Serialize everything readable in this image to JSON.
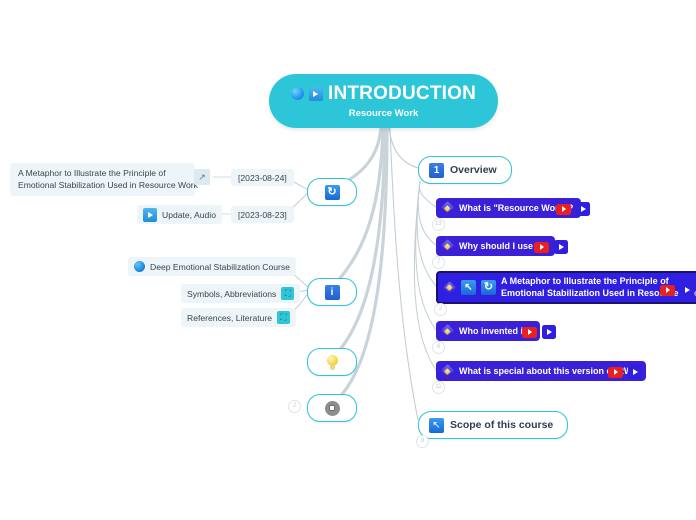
{
  "root": {
    "title": "INTRODUCTION",
    "subtitle": "Resource Work",
    "icons": [
      "sphere-icon",
      "play-icon"
    ]
  },
  "right_branches": [
    {
      "label": "Overview",
      "icon": "number-one-icon",
      "icon_text": "1",
      "type": "outline"
    },
    {
      "label": "Scope of this course",
      "icon": "arrow-expand-icon",
      "icon_text": "↖",
      "type": "outline"
    }
  ],
  "topics": [
    {
      "label": "What is \"Resource Work\"?",
      "icons": [
        "gem-icon"
      ],
      "badges": [
        "youtube-badge",
        "play-badge"
      ],
      "count": "13"
    },
    {
      "label": "Why should I use it?",
      "icons": [
        "gem-icon"
      ],
      "badges": [
        "youtube-badge",
        "play-badge"
      ],
      "count": "7"
    },
    {
      "label_line1": "A Metaphor to Illustrate the Principle of",
      "label_line2": "Emotional Stabilization Used in Resource Work",
      "icons": [
        "gem-icon",
        "arrow-expand-icon",
        "sync-icon"
      ],
      "badges": [
        "youtube-badge",
        "play-badge"
      ],
      "count": "2",
      "selected": true
    },
    {
      "label": "Who invented it?",
      "icons": [
        "gem-icon"
      ],
      "badges": [
        "youtube-badge",
        "play-badge"
      ],
      "count": "6"
    },
    {
      "label": "What is special about this version of RW?",
      "icons": [
        "gem-icon"
      ],
      "badges": [
        "youtube-badge",
        "play-badge"
      ],
      "count": "11"
    }
  ],
  "spine_nodes": [
    {
      "icon": "sync-icon",
      "glyph": "↻"
    },
    {
      "icon": "info-icon",
      "glyph": "i"
    },
    {
      "icon": "lightbulb-icon",
      "glyph": ""
    },
    {
      "icon": "target-icon",
      "glyph": "",
      "count": "2"
    }
  ],
  "left_items": {
    "metaphor_note": {
      "line1": "A Metaphor to Illustrate the Principle of",
      "line2": "Emotional Stabilization Used in Resource Work",
      "link_icon": "external-link-icon",
      "date": "[2023-08-24]"
    },
    "update_audio": {
      "label": "Update, Audio",
      "icon": "play-icon",
      "date": "[2023-08-23]"
    },
    "course": {
      "label": "Deep Emotional Stabilization Course",
      "icon": "blue-dot-icon"
    },
    "symbols": {
      "label": "Symbols, Abbreviations",
      "icon": "expand-icon"
    },
    "references": {
      "label": "References, Literature",
      "icon": "expand-icon"
    }
  },
  "colors": {
    "root_fill": "#2cc6d8",
    "accent_teal": "#2cc6d8",
    "topic_purple": "#3a21d8",
    "selected_border": "#1a1070",
    "youtube_red": "#e8201e",
    "note_bg": "#eef5f8",
    "background": "#ffffff"
  }
}
